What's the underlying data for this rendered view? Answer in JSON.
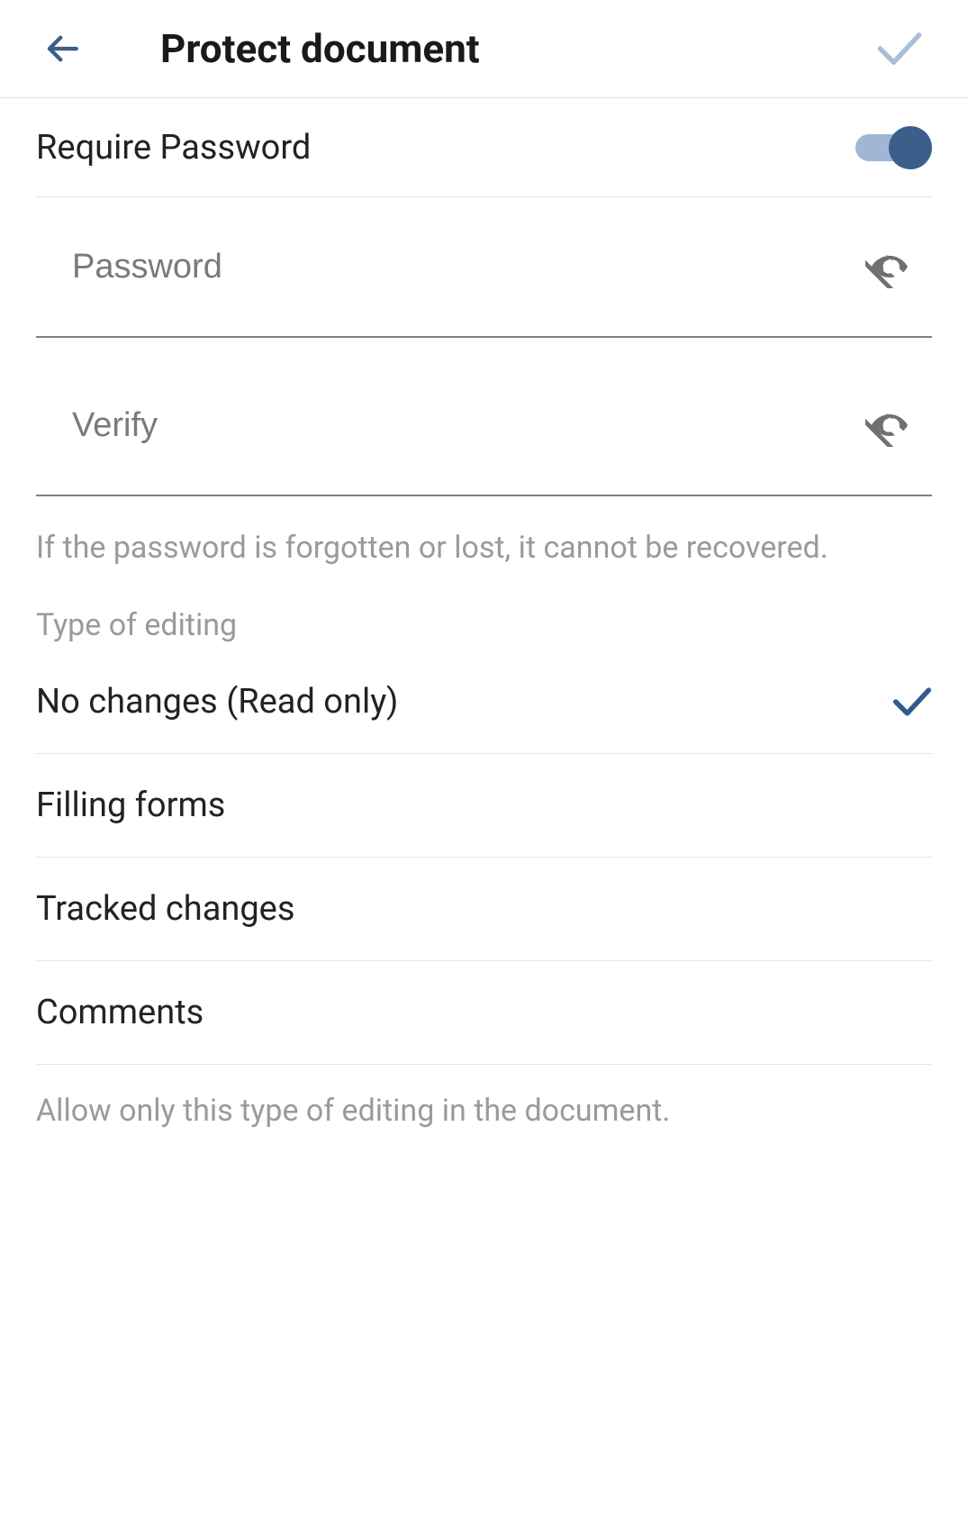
{
  "header": {
    "title": "Protect document"
  },
  "requirePassword": {
    "label": "Require Password",
    "enabled": true
  },
  "fields": {
    "password": {
      "placeholder": "Password",
      "value": ""
    },
    "verify": {
      "placeholder": "Verify",
      "value": ""
    }
  },
  "hints": {
    "passwordLost": "If the password is forgotten or lost, it cannot be recovered."
  },
  "editing": {
    "categoryLabel": "Type of editing",
    "options": [
      {
        "label": "No changes (Read only)",
        "selected": true
      },
      {
        "label": "Filling forms",
        "selected": false
      },
      {
        "label": "Tracked changes",
        "selected": false
      },
      {
        "label": "Comments",
        "selected": false
      }
    ],
    "footerHint": "Allow only this type of editing in the document."
  }
}
